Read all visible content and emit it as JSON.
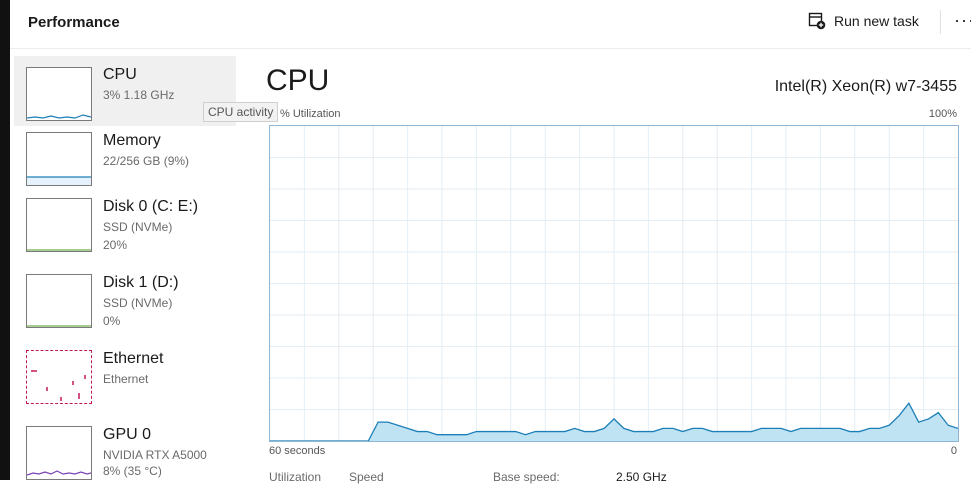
{
  "header": {
    "title": "Performance",
    "run_new_task": "Run new task",
    "more_label": "···"
  },
  "sidebar": {
    "items": [
      {
        "name": "CPU",
        "line1": "3%  1.18 GHz",
        "line2": "",
        "selected": true,
        "color": "#1d7fb8"
      },
      {
        "name": "Memory",
        "line1": "22/256 GB (9%)",
        "line2": "",
        "selected": false,
        "color": "#8b2fb2"
      },
      {
        "name": "Disk 0 (C: E:)",
        "line1": "SSD (NVMe)",
        "line2": "20%",
        "selected": false,
        "color": "#4c9a2a"
      },
      {
        "name": "Disk 1 (D:)",
        "line1": "SSD (NVMe)",
        "line2": "0%",
        "selected": false,
        "color": "#4c9a2a"
      },
      {
        "name": "Ethernet",
        "line1": "Ethernet",
        "line2": "",
        "selected": false,
        "color": "#c2185b"
      },
      {
        "name": "GPU 0",
        "line1": "NVIDIA RTX A5000",
        "line2": "8%  (35 °C)",
        "selected": false,
        "color": "#7b3fb6"
      }
    ]
  },
  "tooltip": "CPU activity",
  "main": {
    "title": "CPU",
    "model": "Intel(R) Xeon(R) w7-3455",
    "util_label": "% Utilization",
    "max_label": "100%",
    "time_left": "60 seconds",
    "time_right": "0",
    "accent": "#1d7fb8",
    "fill": "#bfe3f3",
    "grid": "#e3eef6",
    "utilization_history": [
      0,
      0,
      0,
      0,
      0,
      0,
      0,
      0,
      0,
      0,
      0,
      6,
      6,
      5,
      4,
      3,
      3,
      2,
      2,
      2,
      2,
      3,
      3,
      3,
      3,
      3,
      2,
      3,
      3,
      3,
      3,
      4,
      3,
      3,
      4,
      7,
      4,
      3,
      3,
      3,
      4,
      4,
      3,
      4,
      4,
      3,
      3,
      3,
      3,
      3,
      4,
      4,
      4,
      3,
      4,
      4,
      4,
      4,
      4,
      3,
      3,
      4,
      4,
      5,
      8,
      12,
      6,
      7,
      9,
      5,
      4
    ]
  },
  "stats": {
    "utilization": "Utilization",
    "speed": "Speed",
    "base_speed": "Base speed:",
    "base_speed_value": "2.50 GHz"
  }
}
